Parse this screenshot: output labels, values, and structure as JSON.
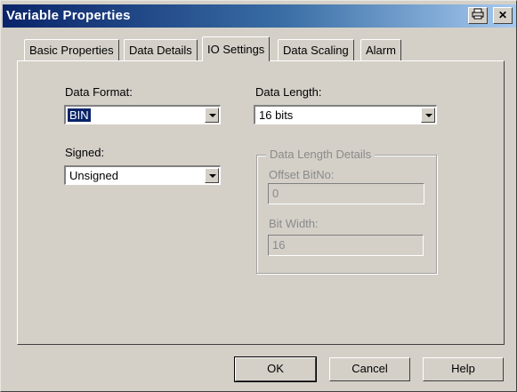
{
  "window": {
    "title": "Variable Properties",
    "print_icon": "printer-icon",
    "close_icon": "close-icon"
  },
  "tabs": [
    {
      "label": "Basic Properties",
      "active": false
    },
    {
      "label": "Data Details",
      "active": false
    },
    {
      "label": "IO Settings",
      "active": true
    },
    {
      "label": "Data Scaling",
      "active": false
    },
    {
      "label": "Alarm",
      "active": false
    }
  ],
  "io_settings": {
    "data_format": {
      "label": "Data Format:",
      "value": "BIN"
    },
    "data_length": {
      "label": "Data Length:",
      "value": "16 bits"
    },
    "signed": {
      "label": "Signed:",
      "value": "Unsigned"
    },
    "length_details": {
      "title": "Data Length Details",
      "offset_bitno": {
        "label": "Offset BitNo:",
        "value": "0"
      },
      "bit_width": {
        "label": "Bit Width:",
        "value": "16"
      }
    }
  },
  "buttons": {
    "ok": "OK",
    "cancel": "Cancel",
    "help": "Help"
  },
  "colors": {
    "face": "#d4d0c8",
    "title_start": "#0a246a",
    "title_end": "#a6caf0",
    "selection": "#0a246a"
  }
}
